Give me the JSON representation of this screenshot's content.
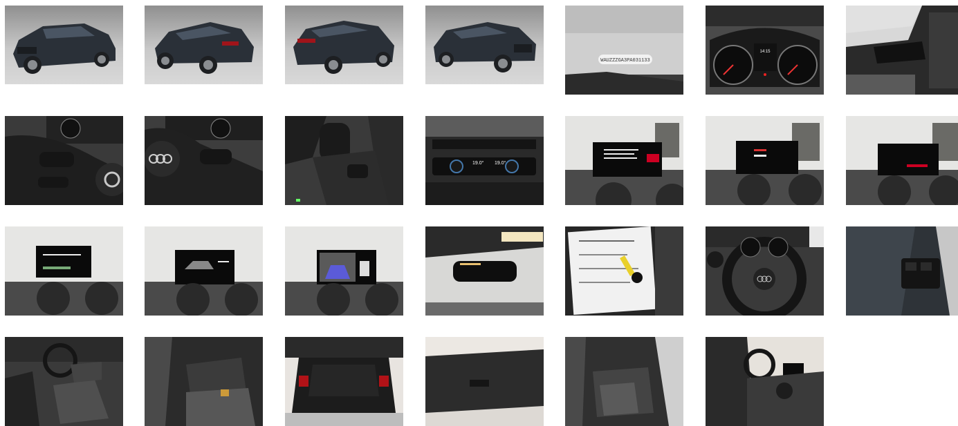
{
  "gallery": {
    "vin_plate_text": "WAUZZZGA3PA031133",
    "cluster_clock": "14:15",
    "climate_temps": [
      "19.0°",
      "19.0°"
    ],
    "photos": [
      {
        "icon": "car-front-left-photo"
      },
      {
        "icon": "car-rear-left-photo"
      },
      {
        "icon": "car-rear-right-photo"
      },
      {
        "icon": "car-front-right-photo"
      },
      {
        "icon": "vin-plate-photo"
      },
      {
        "icon": "instrument-cluster-photo"
      },
      {
        "icon": "column-stalk-photo"
      },
      {
        "icon": "steering-wheel-left-photo"
      },
      {
        "icon": "steering-wheel-right-photo"
      },
      {
        "icon": "gear-selector-photo"
      },
      {
        "icon": "climate-control-photo"
      },
      {
        "icon": "infotainment-menu-photo"
      },
      {
        "icon": "infotainment-screen-2-photo"
      },
      {
        "icon": "infotainment-screen-3-photo"
      },
      {
        "icon": "infotainment-screen-4-photo"
      },
      {
        "icon": "infotainment-car-status-photo"
      },
      {
        "icon": "reversing-camera-photo"
      },
      {
        "icon": "rearview-mirror-photo"
      },
      {
        "icon": "service-documents-keys-photo"
      },
      {
        "icon": "dashboard-steering-photo"
      },
      {
        "icon": "door-switches-photo"
      },
      {
        "icon": "front-seats-photo"
      },
      {
        "icon": "rear-seats-photo"
      },
      {
        "icon": "open-trunk-photo"
      },
      {
        "icon": "trunk-cover-photo"
      },
      {
        "icon": "rear-seat-side-photo"
      },
      {
        "icon": "interior-passenger-side-photo"
      }
    ]
  }
}
